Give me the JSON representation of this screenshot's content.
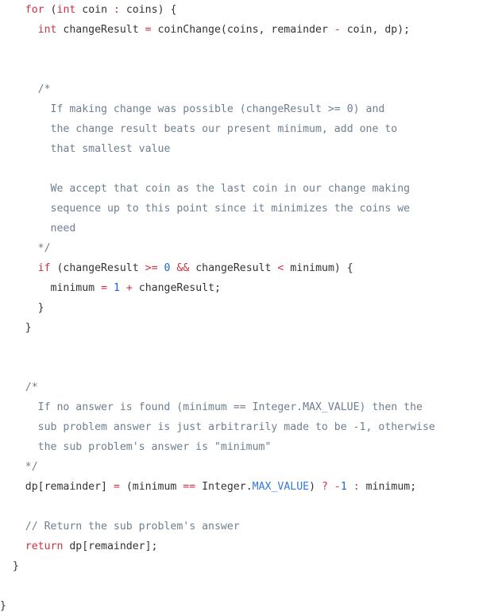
{
  "document": {
    "type": "source-code-snippet",
    "language": "java",
    "background_color": "#ffffff",
    "colors": {
      "keyword": "#cc3344",
      "operator": "#cc3344",
      "number": "#1a66cc",
      "constant": "#3377dd",
      "comment": "#6e7f90",
      "plain": "#333333"
    },
    "full_text": "    for (int coin : coins) {\n      int changeResult = coinChange(coins, remainder - coin, dp);\n\n\n      /*\n        If making change was possible (changeResult >= 0) and\n        the change result beats our present minimum, add one to\n        that smallest value\n\n        We accept that coin as the last coin in our change making\n        sequence up to this point since it minimizes the coins we\n        need\n      */\n      if (changeResult >= 0 && changeResult < minimum) {\n        minimum = 1 + changeResult;\n      }\n    }\n\n\n    /*\n      If no answer is found (minimum == Integer.MAX_VALUE) then the\n      sub problem answer is just arbitrarily made to be -1, otherwise\n      the sub problem's answer is \"minimum\"\n    */\n    dp[remainder] = (minimum == Integer.MAX_VALUE) ? -1 : minimum;\n\n    // Return the sub problem's answer\n    return dp[remainder];\n  }\n\n}",
    "lines": [
      {
        "indent": 4,
        "tokens": [
          {
            "t": "for",
            "c": "kw"
          },
          {
            "t": " ",
            "c": "pln"
          },
          {
            "t": "(",
            "c": "pun"
          },
          {
            "t": "int",
            "c": "kw"
          },
          {
            "t": " coin ",
            "c": "pln"
          },
          {
            "t": ":",
            "c": "op"
          },
          {
            "t": " coins",
            "c": "pln"
          },
          {
            "t": ") {",
            "c": "pun"
          }
        ]
      },
      {
        "indent": 6,
        "tokens": [
          {
            "t": "int",
            "c": "kw"
          },
          {
            "t": " changeResult ",
            "c": "pln"
          },
          {
            "t": "=",
            "c": "op"
          },
          {
            "t": " coinChange(coins, remainder ",
            "c": "pln"
          },
          {
            "t": "-",
            "c": "op"
          },
          {
            "t": " coin, dp);",
            "c": "pln"
          }
        ]
      },
      {
        "indent": 0,
        "tokens": []
      },
      {
        "indent": 0,
        "tokens": []
      },
      {
        "indent": 6,
        "tokens": [
          {
            "t": "/*",
            "c": "cmt"
          }
        ]
      },
      {
        "indent": 8,
        "tokens": [
          {
            "t": "If making change was possible (changeResult >= 0) and",
            "c": "cmt"
          }
        ]
      },
      {
        "indent": 8,
        "tokens": [
          {
            "t": "the change result beats our present minimum, add one to",
            "c": "cmt"
          }
        ]
      },
      {
        "indent": 8,
        "tokens": [
          {
            "t": "that smallest value",
            "c": "cmt"
          }
        ]
      },
      {
        "indent": 0,
        "tokens": []
      },
      {
        "indent": 8,
        "tokens": [
          {
            "t": "We accept that coin as the last coin in our change making",
            "c": "cmt"
          }
        ]
      },
      {
        "indent": 8,
        "tokens": [
          {
            "t": "sequence up to this point since it minimizes the coins we",
            "c": "cmt"
          }
        ]
      },
      {
        "indent": 8,
        "tokens": [
          {
            "t": "need",
            "c": "cmt"
          }
        ]
      },
      {
        "indent": 6,
        "tokens": [
          {
            "t": "*/",
            "c": "cmt"
          }
        ]
      },
      {
        "indent": 6,
        "tokens": [
          {
            "t": "if",
            "c": "kw"
          },
          {
            "t": " (changeResult ",
            "c": "pln"
          },
          {
            "t": ">=",
            "c": "op"
          },
          {
            "t": " ",
            "c": "pln"
          },
          {
            "t": "0",
            "c": "num"
          },
          {
            "t": " ",
            "c": "pln"
          },
          {
            "t": "&&",
            "c": "op"
          },
          {
            "t": " changeResult ",
            "c": "pln"
          },
          {
            "t": "<",
            "c": "op"
          },
          {
            "t": " minimum) {",
            "c": "pln"
          }
        ]
      },
      {
        "indent": 8,
        "tokens": [
          {
            "t": "minimum ",
            "c": "pln"
          },
          {
            "t": "=",
            "c": "op"
          },
          {
            "t": " ",
            "c": "pln"
          },
          {
            "t": "1",
            "c": "num"
          },
          {
            "t": " ",
            "c": "pln"
          },
          {
            "t": "+",
            "c": "op"
          },
          {
            "t": " changeResult;",
            "c": "pln"
          }
        ]
      },
      {
        "indent": 6,
        "tokens": [
          {
            "t": "}",
            "c": "pun"
          }
        ]
      },
      {
        "indent": 4,
        "tokens": [
          {
            "t": "}",
            "c": "pun"
          }
        ]
      },
      {
        "indent": 0,
        "tokens": []
      },
      {
        "indent": 0,
        "tokens": []
      },
      {
        "indent": 4,
        "tokens": [
          {
            "t": "/*",
            "c": "cmt"
          }
        ]
      },
      {
        "indent": 6,
        "tokens": [
          {
            "t": "If no answer is found (minimum == Integer.MAX_VALUE) then the",
            "c": "cmt"
          }
        ]
      },
      {
        "indent": 6,
        "tokens": [
          {
            "t": "sub problem answer is just arbitrarily made to be -1, otherwise",
            "c": "cmt"
          }
        ]
      },
      {
        "indent": 6,
        "tokens": [
          {
            "t": "the sub problem's answer is \"minimum\"",
            "c": "cmt"
          }
        ]
      },
      {
        "indent": 4,
        "tokens": [
          {
            "t": "*/",
            "c": "cmt"
          }
        ]
      },
      {
        "indent": 4,
        "tokens": [
          {
            "t": "dp[remainder] ",
            "c": "pln"
          },
          {
            "t": "=",
            "c": "op"
          },
          {
            "t": " (minimum ",
            "c": "pln"
          },
          {
            "t": "==",
            "c": "op"
          },
          {
            "t": " Integer.",
            "c": "pln"
          },
          {
            "t": "MAX_VALUE",
            "c": "con"
          },
          {
            "t": ") ",
            "c": "pln"
          },
          {
            "t": "?",
            "c": "op"
          },
          {
            "t": " ",
            "c": "pln"
          },
          {
            "t": "-",
            "c": "op"
          },
          {
            "t": "1",
            "c": "num"
          },
          {
            "t": " ",
            "c": "pln"
          },
          {
            "t": ":",
            "c": "op"
          },
          {
            "t": " minimum;",
            "c": "pln"
          }
        ]
      },
      {
        "indent": 0,
        "tokens": []
      },
      {
        "indent": 4,
        "tokens": [
          {
            "t": "// Return the sub problem's answer",
            "c": "cmt"
          }
        ]
      },
      {
        "indent": 4,
        "tokens": [
          {
            "t": "return",
            "c": "kw"
          },
          {
            "t": " dp[remainder];",
            "c": "pln"
          }
        ]
      },
      {
        "indent": 2,
        "tokens": [
          {
            "t": "}",
            "c": "pun"
          }
        ]
      },
      {
        "indent": 0,
        "tokens": []
      },
      {
        "indent": 0,
        "tokens": [
          {
            "t": "}",
            "c": "pun"
          }
        ]
      }
    ]
  }
}
